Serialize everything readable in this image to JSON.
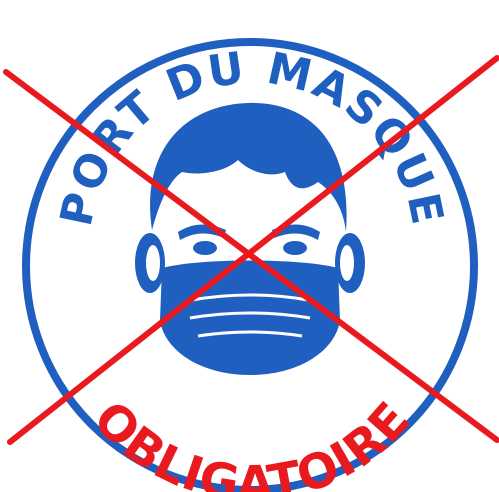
{
  "sign": {
    "top_text": "PORT DU MASQUE",
    "bottom_text": "OBLIGATOIRE",
    "colors": {
      "ring": "#1f5fc0",
      "face": "#1f5fc0",
      "top_text": "#1f5fc0",
      "bottom_text": "#e8191f",
      "cross": "#e8191f",
      "background": "#ffffff"
    },
    "icons": [
      "masked-face-icon",
      "prohibition-cross"
    ]
  }
}
